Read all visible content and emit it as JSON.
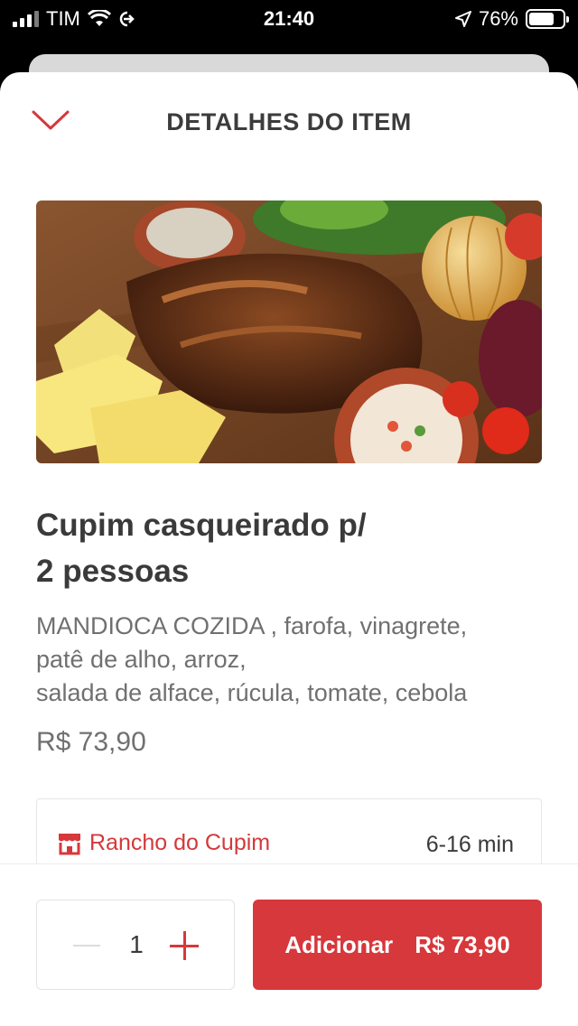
{
  "status_bar": {
    "carrier": "TIM",
    "time": "21:40",
    "battery": "76%",
    "battery_level": 0.76
  },
  "header": {
    "title": "DETALHES DO ITEM",
    "back_icon": "chevron-down-icon"
  },
  "item": {
    "name_line1": "Cupim casqueirado p/",
    "name_line2": "2 pessoas",
    "description_lines": [
      "MANDIOCA COZIDA , farofa, vinagrete,",
      "patê de alho, arroz,",
      "salada de alface, rúcula, tomate, cebola"
    ],
    "price": "R$ 73,90"
  },
  "store": {
    "name": "Rancho do Cupim",
    "icon": "store-icon",
    "eta": "6-16 min"
  },
  "footer": {
    "quantity": "1",
    "add_label": "Adicionar",
    "add_price": "R$ 73,90"
  },
  "colors": {
    "accent": "#d6383b",
    "text": "#3a3a3a",
    "muted": "#707070"
  }
}
